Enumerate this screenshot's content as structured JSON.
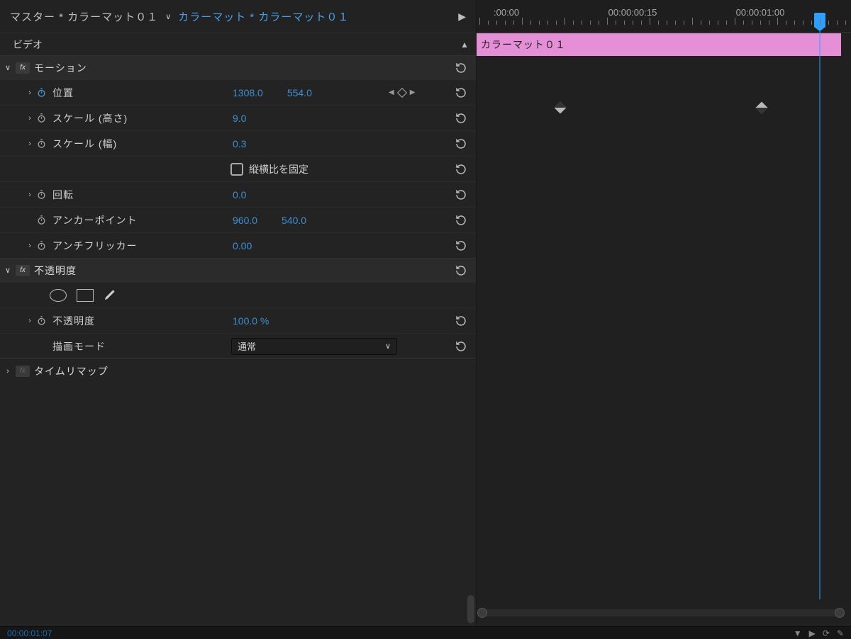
{
  "breadcrumb": {
    "master": "マスター * カラーマット０１",
    "clip": "カラーマット * カラーマット０１"
  },
  "section": {
    "video": "ビデオ"
  },
  "effects": {
    "motion": {
      "name": "モーション",
      "position": {
        "label": "位置",
        "x": "1308.0",
        "y": "554.0"
      },
      "scale_h": {
        "label": "スケール (高さ)",
        "value": "9.0"
      },
      "scale_w": {
        "label": "スケール (幅)",
        "value": "0.3"
      },
      "uniform": {
        "label": "縦横比を固定"
      },
      "rotation": {
        "label": "回転",
        "value": "0.0"
      },
      "anchor": {
        "label": "アンカーポイント",
        "x": "960.0",
        "y": "540.0"
      },
      "antiflicker": {
        "label": "アンチフリッカー",
        "value": "0.00"
      }
    },
    "opacity": {
      "name": "不透明度",
      "opacity": {
        "label": "不透明度",
        "value": "100.0 %"
      },
      "blend": {
        "label": "描画モード",
        "value": "通常"
      }
    },
    "time_remap": {
      "name": "タイムリマップ"
    }
  },
  "timeline": {
    "labels": [
      ":00:00",
      "00:00:00:15",
      "00:00:01:00"
    ],
    "clip_name": "カラーマット０１"
  },
  "footer": {
    "time": "00:00:01:07"
  }
}
